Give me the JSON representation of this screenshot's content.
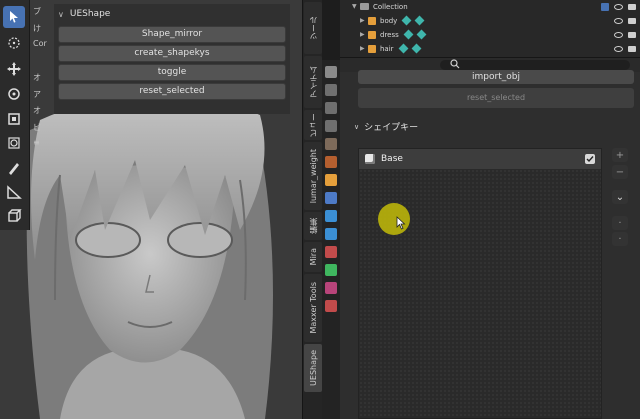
{
  "viewport": {
    "side_letters": [
      "ブ",
      "け",
      "Cor",
      "",
      "オ",
      "ア",
      "オ",
      "ビ",
      "≡"
    ],
    "tools": [
      "select-icon",
      "cursor-icon",
      "move-icon",
      "rotate-icon",
      "scale-icon",
      "transform-icon",
      "annotate-icon",
      "measure-icon",
      "add-cube-icon"
    ],
    "panel": {
      "title": "UEShape",
      "buttons": [
        "Shape_mirror",
        "create_shapekys",
        "toggle",
        "reset_selected"
      ]
    }
  },
  "tab_strip": {
    "tabs": [
      "ツール",
      "アイテム",
      "ビュー",
      "lumar_weight",
      "編集",
      "Mira",
      "Maxxer Tools",
      "UEShape"
    ],
    "active": "UEShape"
  },
  "outliner": {
    "rows": [
      {
        "label": "Collection",
        "kind": "collection"
      },
      {
        "label": "body",
        "kind": "object"
      },
      {
        "label": "dress",
        "kind": "object"
      },
      {
        "label": "hair",
        "kind": "object"
      }
    ]
  },
  "properties": {
    "search_placeholder": "",
    "import_label": "import_obj",
    "second_button_label": "reset_selected",
    "section_title": "シェイプキー",
    "shape_keys": [
      {
        "name": "Base",
        "checked": true
      }
    ],
    "side_buttons": [
      "+",
      "−",
      "⌄",
      "·",
      "·"
    ]
  },
  "colors": {
    "accent": "#4772b3",
    "cursor_highlight": "#bab40a",
    "object_icon": "#e59f3b",
    "modifier_icon": "#3fb6ac"
  }
}
